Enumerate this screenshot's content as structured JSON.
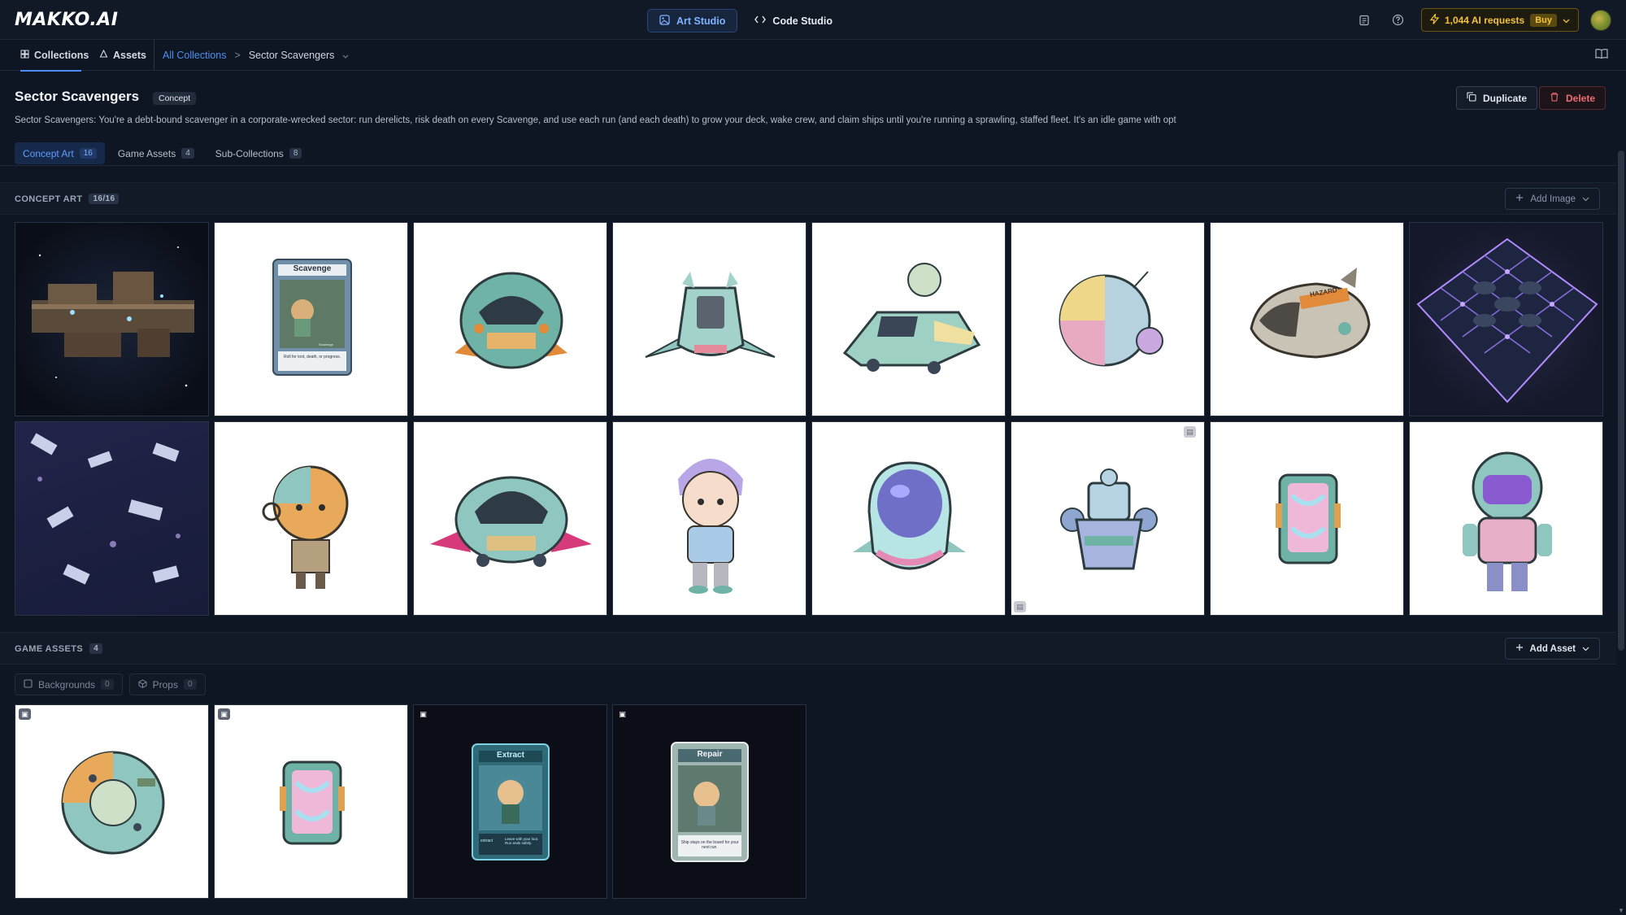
{
  "app": {
    "logo": "MAKKO.AI",
    "studio_tabs": [
      {
        "label": "Art Studio",
        "active": true
      },
      {
        "label": "Code Studio",
        "active": false
      }
    ],
    "requests_label": "1,044 AI requests",
    "buy_label": "Buy"
  },
  "nav": {
    "tabs": [
      {
        "label": "Collections",
        "active": true
      },
      {
        "label": "Assets",
        "active": false
      }
    ],
    "breadcrumb": {
      "root": "All Collections",
      "separator": ">",
      "current": "Sector Scavengers"
    }
  },
  "collection": {
    "title": "Sector Scavengers",
    "badge": "Concept",
    "description": "Sector Scavengers: You're a debt-bound scavenger in a corporate-wrecked sector: run derelicts, risk death on every Scavenge, and use each run (and each death) to grow your deck, wake crew, and claim ships until you're running a sprawling, staffed fleet. It's an idle game with opt",
    "duplicate_label": "Duplicate",
    "delete_label": "Delete",
    "tabs": [
      {
        "label": "Concept Art",
        "count": "16",
        "active": true
      },
      {
        "label": "Game Assets",
        "count": "4",
        "active": false
      },
      {
        "label": "Sub-Collections",
        "count": "8",
        "active": false
      }
    ]
  },
  "concept_art": {
    "label": "CONCEPT ART",
    "count": "16/16",
    "add_label": "Add Image",
    "card_title": "Scavenge",
    "card_text": "Roll for loot, death, or progress.",
    "card_tag": "Scavenge",
    "hazard_text": "HAZARD"
  },
  "game_assets": {
    "label": "GAME ASSETS",
    "count": "4",
    "add_label": "Add Asset",
    "subtabs": [
      {
        "label": "Backgrounds",
        "count": "0"
      },
      {
        "label": "Props",
        "count": "0"
      }
    ],
    "cards": [
      {
        "title": "Extract",
        "text": "Leave with your loot. Run ends safely.",
        "tag": "extract"
      },
      {
        "title": "Repair",
        "text": "Ship stays on the board for your next run."
      }
    ]
  },
  "colors": {
    "accent": "#4a8cff",
    "gold": "#f3c33a",
    "danger": "#ef6b74",
    "background": "#0f1623"
  }
}
